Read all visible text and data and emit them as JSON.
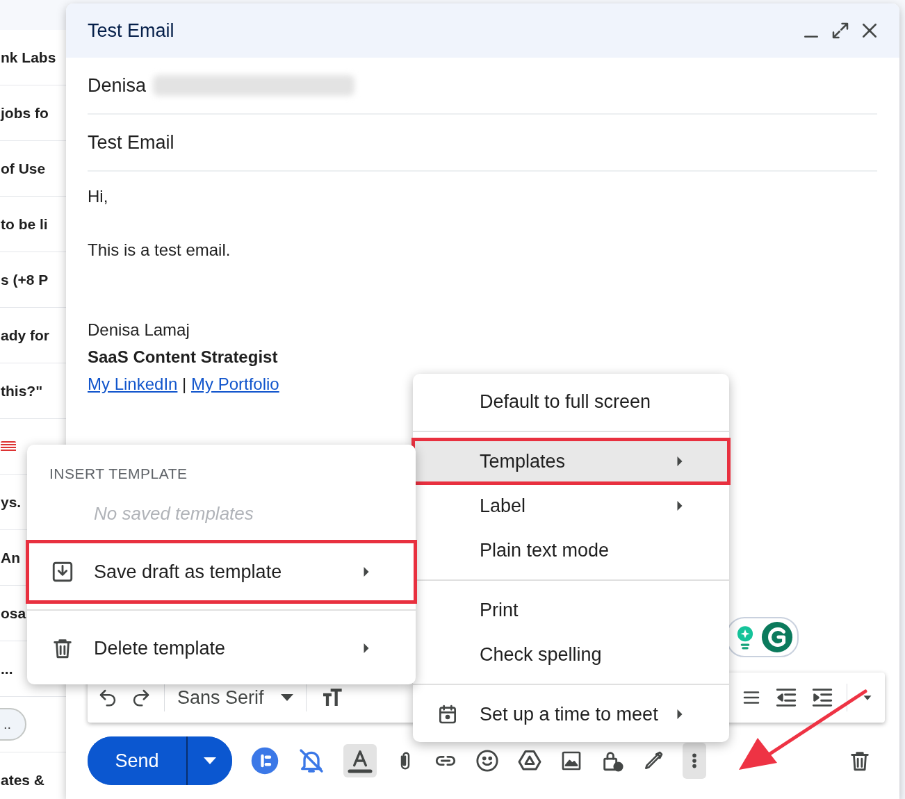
{
  "inbox_background": {
    "rows": [
      {
        "kind": "text",
        "text": "nk Labs"
      },
      {
        "kind": "text",
        "text": "jobs fo"
      },
      {
        "kind": "text",
        "text": "of Use"
      },
      {
        "kind": "text",
        "text": "to be li"
      },
      {
        "kind": "text",
        "text": "s (+8 P"
      },
      {
        "kind": "text",
        "text": "ady for"
      },
      {
        "kind": "text",
        "text": "this?\""
      },
      {
        "kind": "flag"
      },
      {
        "kind": "text",
        "text": "ys."
      },
      {
        "kind": "text",
        "text": "An"
      },
      {
        "kind": "text",
        "text": "osa"
      },
      {
        "kind": "text",
        "text": "..."
      },
      {
        "kind": "pill",
        "text": ".."
      },
      {
        "kind": "text",
        "text": "ates &"
      }
    ]
  },
  "compose": {
    "title": "Test Email",
    "to": {
      "name": "Denisa"
    },
    "subject": "Test Email",
    "body": {
      "greeting": "Hi,",
      "message": "This is a test email.",
      "signature_name": "Denisa Lamaj",
      "signature_title": "SaaS Content Strategist",
      "links": [
        "My LinkedIn",
        "My Portfolio"
      ],
      "separator": "|"
    },
    "format_toolbar": {
      "font": "Sans Serif"
    },
    "send_button": "Send"
  },
  "more_options_menu": {
    "items": [
      {
        "kind": "item",
        "label": "Default to full screen",
        "selected": false,
        "outlined": false,
        "submenu": false
      },
      {
        "kind": "divider"
      },
      {
        "kind": "item",
        "label": "Templates",
        "selected": true,
        "outlined": true,
        "submenu": true
      },
      {
        "kind": "item",
        "label": "Label",
        "selected": false,
        "outlined": false,
        "submenu": true
      },
      {
        "kind": "item",
        "label": "Plain text mode",
        "selected": false,
        "outlined": false,
        "submenu": false
      },
      {
        "kind": "divider"
      },
      {
        "kind": "item",
        "label": "Print",
        "selected": false,
        "outlined": false,
        "submenu": false
      },
      {
        "kind": "item",
        "label": "Check spelling",
        "selected": false,
        "outlined": false,
        "submenu": false
      },
      {
        "kind": "divider"
      },
      {
        "kind": "calendar",
        "label": "Set up a time to meet",
        "selected": false,
        "outlined": false,
        "submenu": true
      }
    ]
  },
  "template_menu": {
    "header": "INSERT TEMPLATE",
    "empty_text": "No saved templates",
    "items": [
      {
        "kind": "save",
        "label": "Save draft as template",
        "selected": false,
        "outlined": true,
        "submenu": true
      },
      {
        "kind": "divider"
      },
      {
        "kind": "delete",
        "label": "Delete template",
        "selected": false,
        "outlined": false,
        "submenu": true
      }
    ]
  }
}
